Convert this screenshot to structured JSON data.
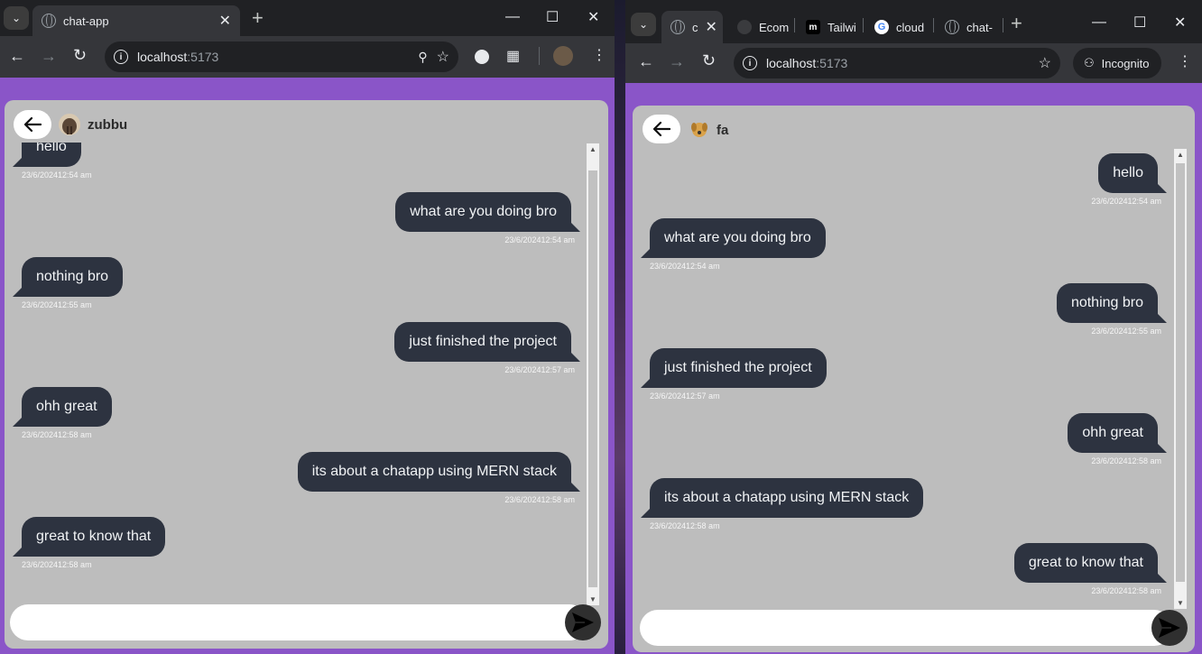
{
  "left": {
    "tab_title": "chat-app",
    "url_host": "localhost",
    "url_port": ":5173",
    "contact_name": "zubbu",
    "input_placeholder": "",
    "messages": [
      {
        "text": "hello",
        "time": "23/6/202412:54 am",
        "side": "in"
      },
      {
        "text": "what are you doing bro",
        "time": "23/6/202412:54 am",
        "side": "out"
      },
      {
        "text": "nothing bro",
        "time": "23/6/202412:55 am",
        "side": "in"
      },
      {
        "text": "just finished the project",
        "time": "23/6/202412:57 am",
        "side": "out"
      },
      {
        "text": "ohh great",
        "time": "23/6/202412:58 am",
        "side": "in"
      },
      {
        "text": "its about a chatapp using MERN stack",
        "time": "23/6/202412:58 am",
        "side": "out"
      },
      {
        "text": "great to know that",
        "time": "23/6/202412:58 am",
        "side": "in"
      }
    ]
  },
  "right": {
    "tabs": [
      {
        "label": "c"
      },
      {
        "label": "Ecom"
      },
      {
        "label": "Tailwi"
      },
      {
        "label": "cloud"
      },
      {
        "label": "chat-"
      }
    ],
    "url_host": "localhost",
    "url_port": ":5173",
    "incognito_label": "Incognito",
    "contact_name": "fa",
    "input_placeholder": "",
    "messages": [
      {
        "text": "hello",
        "time": "23/6/202412:54 am",
        "side": "out"
      },
      {
        "text": "what are you doing bro",
        "time": "23/6/202412:54 am",
        "side": "in"
      },
      {
        "text": "nothing bro",
        "time": "23/6/202412:55 am",
        "side": "out"
      },
      {
        "text": "just finished the project",
        "time": "23/6/202412:57 am",
        "side": "in"
      },
      {
        "text": "ohh great",
        "time": "23/6/202412:58 am",
        "side": "out"
      },
      {
        "text": "its about a chatapp using MERN stack",
        "time": "23/6/202412:58 am",
        "side": "in"
      },
      {
        "text": "great to know that",
        "time": "23/6/202412:58 am",
        "side": "out"
      }
    ]
  },
  "colors": {
    "page_purple": "#8a55c8",
    "card_gray": "#bdbdbd",
    "bubble_dark": "#2d3340"
  }
}
